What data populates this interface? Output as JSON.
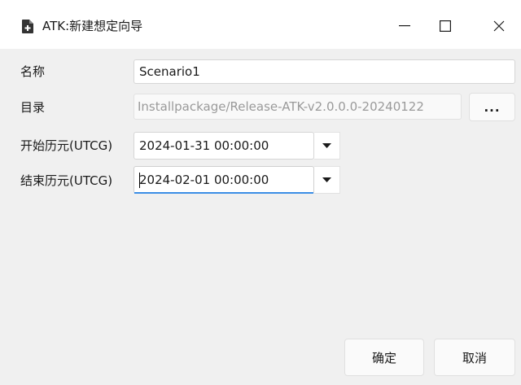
{
  "window": {
    "title": "ATK:新建想定向导",
    "icon": "document-plus-icon",
    "controls": {
      "minimize": "minimize-icon",
      "maximize": "maximize-icon",
      "close": "close-icon"
    }
  },
  "form": {
    "name": {
      "label": "名称",
      "value": "Scenario1"
    },
    "directory": {
      "label": "目录",
      "value": "Installpackage/Release-ATK-v2.0.0.0-20240122",
      "browse_label": "..."
    },
    "start_epoch": {
      "label": "开始历元(UTCG)",
      "value": "2024-01-31 00:00:00"
    },
    "end_epoch": {
      "label": "结束历元(UTCG)",
      "value": "2024-02-01 00:00:00"
    }
  },
  "buttons": {
    "ok": "确定",
    "cancel": "取消"
  },
  "colors": {
    "accent": "#3c8ee6",
    "title_bg": "#ffffff",
    "body_bg": "#f0f0f0"
  }
}
